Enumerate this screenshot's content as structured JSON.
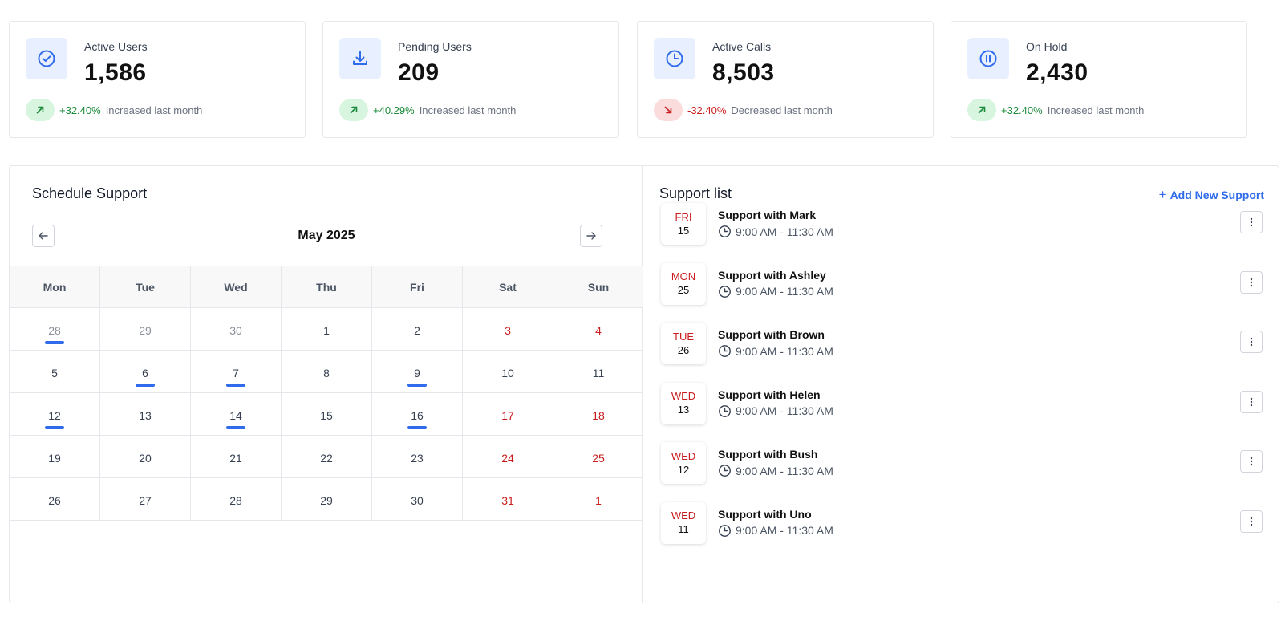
{
  "stats": [
    {
      "label": "Active Users",
      "value": "1,586",
      "trend": "up",
      "pct": "+32.40%",
      "text": "Increased last month",
      "icon": "check-circle-icon"
    },
    {
      "label": "Pending Users",
      "value": "209",
      "trend": "up",
      "pct": "+40.29%",
      "text": "Increased last month",
      "icon": "download-icon"
    },
    {
      "label": "Active Calls",
      "value": "8,503",
      "trend": "down",
      "pct": "-32.40%",
      "text": "Decreased last month",
      "icon": "clock-icon"
    },
    {
      "label": "On Hold",
      "value": "2,430",
      "trend": "up",
      "pct": "+32.40%",
      "text": "Increased last month",
      "icon": "pause-circle-icon"
    }
  ],
  "calendar": {
    "title": "Schedule Support",
    "month": "May 2025",
    "weekdays": [
      "Mon",
      "Tue",
      "Wed",
      "Thu",
      "Fri",
      "Sat",
      "Sun"
    ],
    "weeks": [
      [
        {
          "d": "28",
          "muted": true,
          "mark": true
        },
        {
          "d": "29",
          "muted": true
        },
        {
          "d": "30",
          "muted": true
        },
        {
          "d": "1"
        },
        {
          "d": "2"
        },
        {
          "d": "3",
          "weekend": true
        },
        {
          "d": "4",
          "weekend": true
        }
      ],
      [
        {
          "d": "5"
        },
        {
          "d": "6",
          "mark": true
        },
        {
          "d": "7",
          "mark": true
        },
        {
          "d": "8"
        },
        {
          "d": "9",
          "mark": true
        },
        {
          "d": "10"
        },
        {
          "d": "11"
        }
      ],
      [
        {
          "d": "12",
          "mark": true
        },
        {
          "d": "13"
        },
        {
          "d": "14",
          "mark": true
        },
        {
          "d": "15"
        },
        {
          "d": "16",
          "mark": true
        },
        {
          "d": "17",
          "weekend": true
        },
        {
          "d": "18",
          "weekend": true
        }
      ],
      [
        {
          "d": "19"
        },
        {
          "d": "20"
        },
        {
          "d": "21"
        },
        {
          "d": "22"
        },
        {
          "d": "23"
        },
        {
          "d": "24",
          "weekend": true
        },
        {
          "d": "25",
          "weekend": true
        }
      ],
      [
        {
          "d": "26"
        },
        {
          "d": "27"
        },
        {
          "d": "28"
        },
        {
          "d": "29"
        },
        {
          "d": "30"
        },
        {
          "d": "31",
          "weekend": true
        },
        {
          "d": "1",
          "weekend": true
        }
      ]
    ]
  },
  "support": {
    "title": "Support list",
    "add_label": "Add New Support",
    "items": [
      {
        "day": "FRI",
        "date": "15",
        "name": "Support with Mark",
        "time": "9:00 AM - 11:30 AM"
      },
      {
        "day": "MON",
        "date": "25",
        "name": "Support with Ashley",
        "time": "9:00 AM - 11:30 AM"
      },
      {
        "day": "TUE",
        "date": "26",
        "name": "Support with Brown",
        "time": "9:00 AM - 11:30 AM"
      },
      {
        "day": "WED",
        "date": "13",
        "name": "Support with Helen",
        "time": "9:00 AM - 11:30 AM"
      },
      {
        "day": "WED",
        "date": "12",
        "name": "Support with Bush",
        "time": "9:00 AM - 11:30 AM"
      },
      {
        "day": "WED",
        "date": "11",
        "name": "Support with Uno",
        "time": "9:00 AM - 11:30 AM"
      }
    ]
  },
  "colors": {
    "accent": "#2f6bea",
    "positive": "#1a8a3a",
    "negative": "#c81e1e"
  }
}
